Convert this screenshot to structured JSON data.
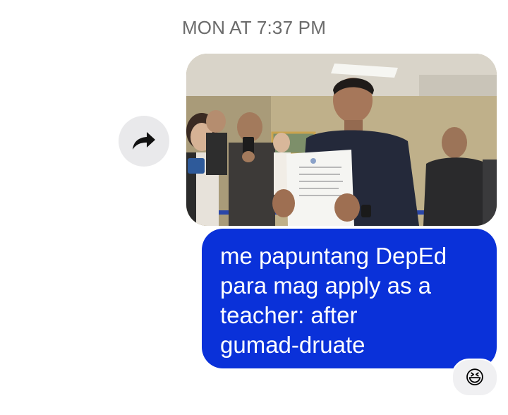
{
  "thread": {
    "timestamp": "MON AT 7:37 PM"
  },
  "actions": {
    "forward_icon": "forward-share-icon"
  },
  "message": {
    "text": "me papuntang DepEd\npara mag apply as a\nteacher: after\ngumad-druate",
    "bubble_color": "#0a31d9",
    "text_color": "#ffffff"
  },
  "photo": {
    "description_icon": "photo-attachment"
  },
  "reaction": {
    "emoji": "😆"
  }
}
